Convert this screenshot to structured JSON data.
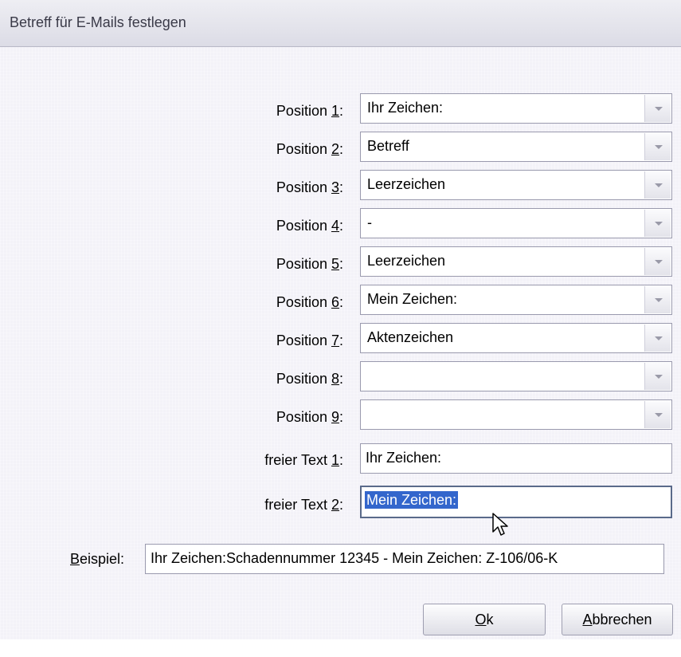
{
  "window": {
    "title": "Betreff für E-Mails festlegen"
  },
  "positions": [
    {
      "label_pre": "Position ",
      "mnemonic": "1",
      "label_post": ":",
      "value": "Ihr Zeichen:"
    },
    {
      "label_pre": "Position ",
      "mnemonic": "2",
      "label_post": ":",
      "value": "Betreff"
    },
    {
      "label_pre": "Position ",
      "mnemonic": "3",
      "label_post": ":",
      "value": "Leerzeichen"
    },
    {
      "label_pre": "Position ",
      "mnemonic": "4",
      "label_post": ":",
      "value": "-"
    },
    {
      "label_pre": "Position ",
      "mnemonic": "5",
      "label_post": ":",
      "value": "Leerzeichen"
    },
    {
      "label_pre": "Position ",
      "mnemonic": "6",
      "label_post": ":",
      "value": "Mein Zeichen:"
    },
    {
      "label_pre": "Position ",
      "mnemonic": "7",
      "label_post": ":",
      "value": "Aktenzeichen"
    },
    {
      "label_pre": "Position ",
      "mnemonic": "8",
      "label_post": ":",
      "value": ""
    },
    {
      "label_pre": "Position ",
      "mnemonic": "9",
      "label_post": ":",
      "value": ""
    }
  ],
  "free_texts": [
    {
      "label_pre": "freier Text ",
      "mnemonic": "1",
      "label_post": ":",
      "value": "Ihr Zeichen:"
    },
    {
      "label_pre": "freier Text ",
      "mnemonic": "2",
      "label_post": ":",
      "value": "Mein Zeichen:"
    }
  ],
  "example": {
    "label_mnemonic": "B",
    "label_rest": "eispiel:",
    "value": "Ihr Zeichen:Schadennummer 12345 - Mein Zeichen: Z-106/06-K"
  },
  "buttons": {
    "ok_mnemonic": "O",
    "ok_rest": "k",
    "cancel_mnemonic": "A",
    "cancel_rest": "bbrechen"
  },
  "icons": {
    "cursor": "mouse-pointer-icon",
    "dropdown": "chevron-down-icon"
  }
}
